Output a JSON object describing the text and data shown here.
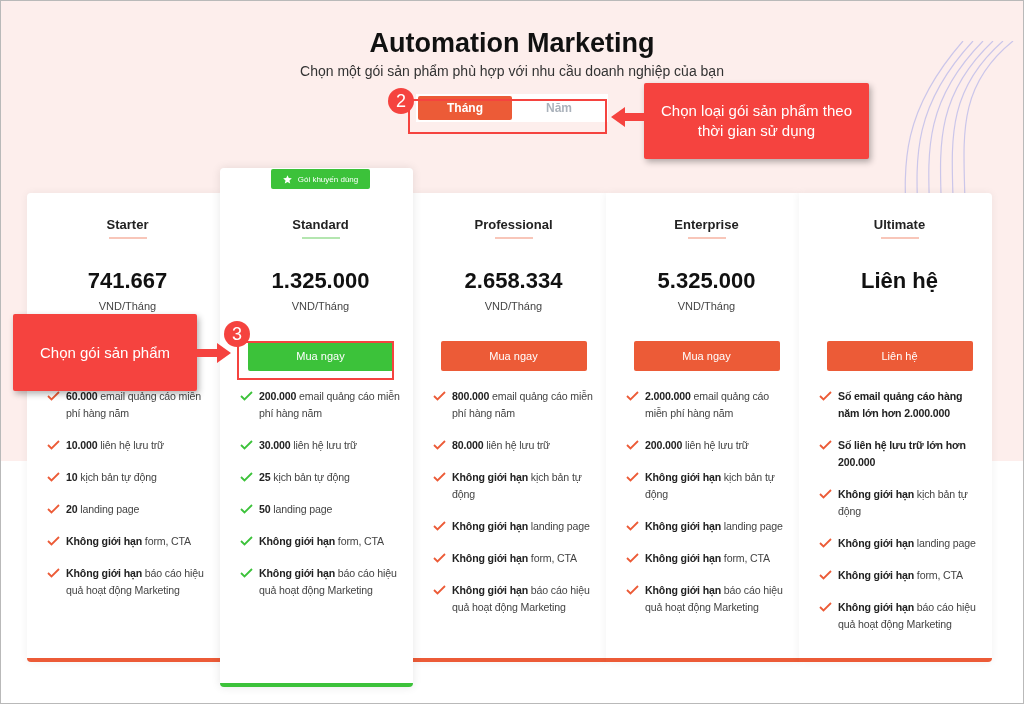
{
  "header": {
    "title": "Automation Marketing",
    "subtitle": "Chọn một gói sản phẩm phù hợp với nhu cầu doanh nghiệp của bạn"
  },
  "billing_toggle": [
    {
      "label": "Tháng",
      "selected": true
    },
    {
      "label": "Năm",
      "selected": false
    }
  ],
  "plans": [
    {
      "name": "Starter",
      "price": "741.667",
      "per": "VND/Tháng",
      "featured": false,
      "features": [
        {
          "text": "**60.000** email quảng cáo miễn phí hàng năm",
          "bold": false
        },
        {
          "text": "**10.000** liên hệ lưu trữ",
          "bold": false
        },
        {
          "text": "**10** kịch bản tự động",
          "bold": false
        },
        {
          "text": "**20** landing page",
          "bold": false
        },
        {
          "text": "**Không giới hạn** form, CTA",
          "bold": false
        },
        {
          "text": "**Không giới hạn** báo cáo hiệu quả hoạt động Marketing",
          "bold": false
        }
      ]
    },
    {
      "name": "Standard",
      "badge": "Gói khuyến dùng",
      "price": "1.325.000",
      "per": "VND/Tháng",
      "button": "Mua ngay",
      "featured": true,
      "features": [
        {
          "text": "**200.000** email quảng cáo miễn phí hàng năm",
          "bold": false
        },
        {
          "text": "**30.000** liên hệ lưu trữ",
          "bold": false
        },
        {
          "text": "**25** kịch bản tự động",
          "bold": false
        },
        {
          "text": "**50** landing page",
          "bold": false
        },
        {
          "text": "**Không giới hạn** form, CTA",
          "bold": false
        },
        {
          "text": "**Không giới hạn** báo cáo hiệu quả hoạt động Marketing",
          "bold": false
        }
      ]
    },
    {
      "name": "Professional",
      "price": "2.658.334",
      "per": "VND/Tháng",
      "button": "Mua ngay",
      "featured": false,
      "features": [
        {
          "text": "**800.000** email quảng cáo miễn phí hàng năm",
          "bold": false
        },
        {
          "text": "**80.000** liên hệ lưu trữ",
          "bold": false
        },
        {
          "text": "**Không giới hạn** kịch bản tự động",
          "bold": false
        },
        {
          "text": "**Không giới hạn** landing page",
          "bold": false
        },
        {
          "text": "**Không giới hạn** form, CTA",
          "bold": false
        },
        {
          "text": "**Không giới hạn** báo cáo hiệu quả hoạt động Marketing",
          "bold": false
        }
      ]
    },
    {
      "name": "Enterprise",
      "price": "5.325.000",
      "per": "VND/Tháng",
      "button": "Mua ngay",
      "featured": false,
      "features": [
        {
          "text": "**2.000.000** email quảng cáo miễn phí hàng năm",
          "bold": false
        },
        {
          "text": "**200.000** liên hệ lưu trữ",
          "bold": false
        },
        {
          "text": "**Không giới hạn** kịch bản tự động",
          "bold": false
        },
        {
          "text": "**Không giới hạn** landing page",
          "bold": false
        },
        {
          "text": "**Không giới hạn** form, CTA",
          "bold": false
        },
        {
          "text": "**Không giới hạn** báo cáo hiệu quả hoạt động Marketing",
          "bold": false
        }
      ]
    },
    {
      "name": "Ultimate",
      "price": "Liên hệ",
      "button": "Liên hệ",
      "featured": false,
      "features": [
        {
          "text": "Số email quảng cáo hàng năm lớn hơn 2.000.000",
          "bold": true
        },
        {
          "text": "Số liên hệ lưu trữ lớn hơn 200.000",
          "bold": true
        },
        {
          "text": "**Không giới hạn** kịch bản tự động",
          "bold": false
        },
        {
          "text": "**Không giới hạn** landing page",
          "bold": false
        },
        {
          "text": "**Không giới hạn** form, CTA",
          "bold": false
        },
        {
          "text": "**Không giới hạn** báo cáo hiệu quả hoạt động Marketing",
          "bold": false
        }
      ]
    }
  ],
  "annotations": [
    {
      "number": "2",
      "text": "Chọn loại gói sản phẩm theo thời gian sử dụng"
    },
    {
      "number": "3",
      "text": "Chọn gói sản phẩm"
    }
  ]
}
